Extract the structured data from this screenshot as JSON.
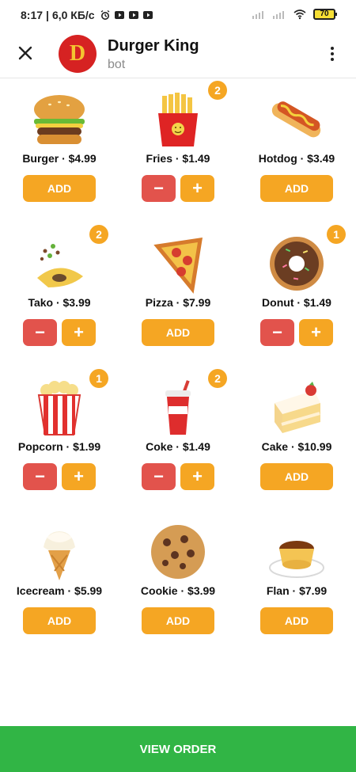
{
  "status_bar": {
    "time": "8:17",
    "network": "6,0 КБ/с",
    "battery": "70"
  },
  "header": {
    "avatar_letter": "D",
    "title": "Durger King",
    "subtitle": "bot"
  },
  "items": [
    {
      "label": "Burger · $4.99",
      "count": 0
    },
    {
      "label": "Fries · $1.49",
      "count": 2
    },
    {
      "label": "Hotdog · $3.49",
      "count": 0
    },
    {
      "label": "Tako · $3.99",
      "count": 2
    },
    {
      "label": "Pizza · $7.99",
      "count": 0
    },
    {
      "label": "Donut · $1.49",
      "count": 1
    },
    {
      "label": "Popcorn · $1.99",
      "count": 1
    },
    {
      "label": "Coke · $1.49",
      "count": 2
    },
    {
      "label": "Cake · $10.99",
      "count": 0
    },
    {
      "label": "Icecream · $5.99",
      "count": 0
    },
    {
      "label": "Cookie · $3.99",
      "count": 0
    },
    {
      "label": "Flan · $7.99",
      "count": 0
    }
  ],
  "badges": {
    "fries": "2",
    "tako": "2",
    "donut": "1",
    "popcorn": "1",
    "coke": "2"
  },
  "buttons": {
    "add": "ADD",
    "minus": "−",
    "plus": "+"
  },
  "footer": {
    "view_order": "VIEW ORDER"
  },
  "colors": {
    "accent": "#f5a623",
    "minus": "#e2534c",
    "footer": "#31b545"
  }
}
